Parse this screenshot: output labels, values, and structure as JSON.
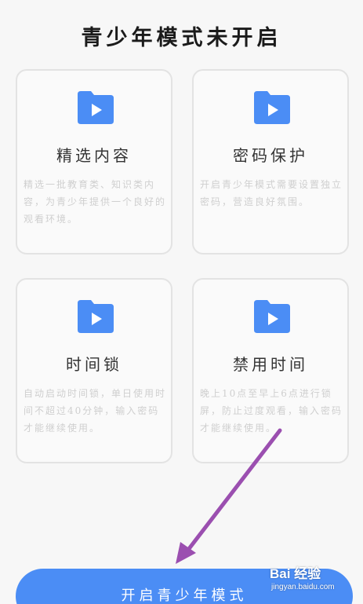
{
  "header": {
    "title": "青少年模式未开启"
  },
  "cards": [
    {
      "icon": "folder-play-icon",
      "title": "精选内容",
      "description": "精选一批教育类、知识类内容，为青少年提供一个良好的观看环境。"
    },
    {
      "icon": "folder-play-icon",
      "title": "密码保护",
      "description": "开启青少年模式需要设置独立密码，营造良好氛围。"
    },
    {
      "icon": "folder-play-icon",
      "title": "时间锁",
      "description": "自动启动时间锁，单日使用时间不超过40分钟，输入密码才能继续使用。"
    },
    {
      "icon": "folder-play-icon",
      "title": "禁用时间",
      "description": "晚上10点至早上6点进行锁屏，防止过度观看，输入密码才能继续使用。"
    }
  ],
  "action": {
    "start_label": "开启青少年模式"
  },
  "annotation": {
    "arrow_color": "#9b4fb0"
  },
  "watermark": {
    "logo_text": "Bai 经验",
    "url": "jingyan.baidu.com"
  },
  "colors": {
    "accent": "#4b8df5",
    "folder": "#4b8df5"
  }
}
